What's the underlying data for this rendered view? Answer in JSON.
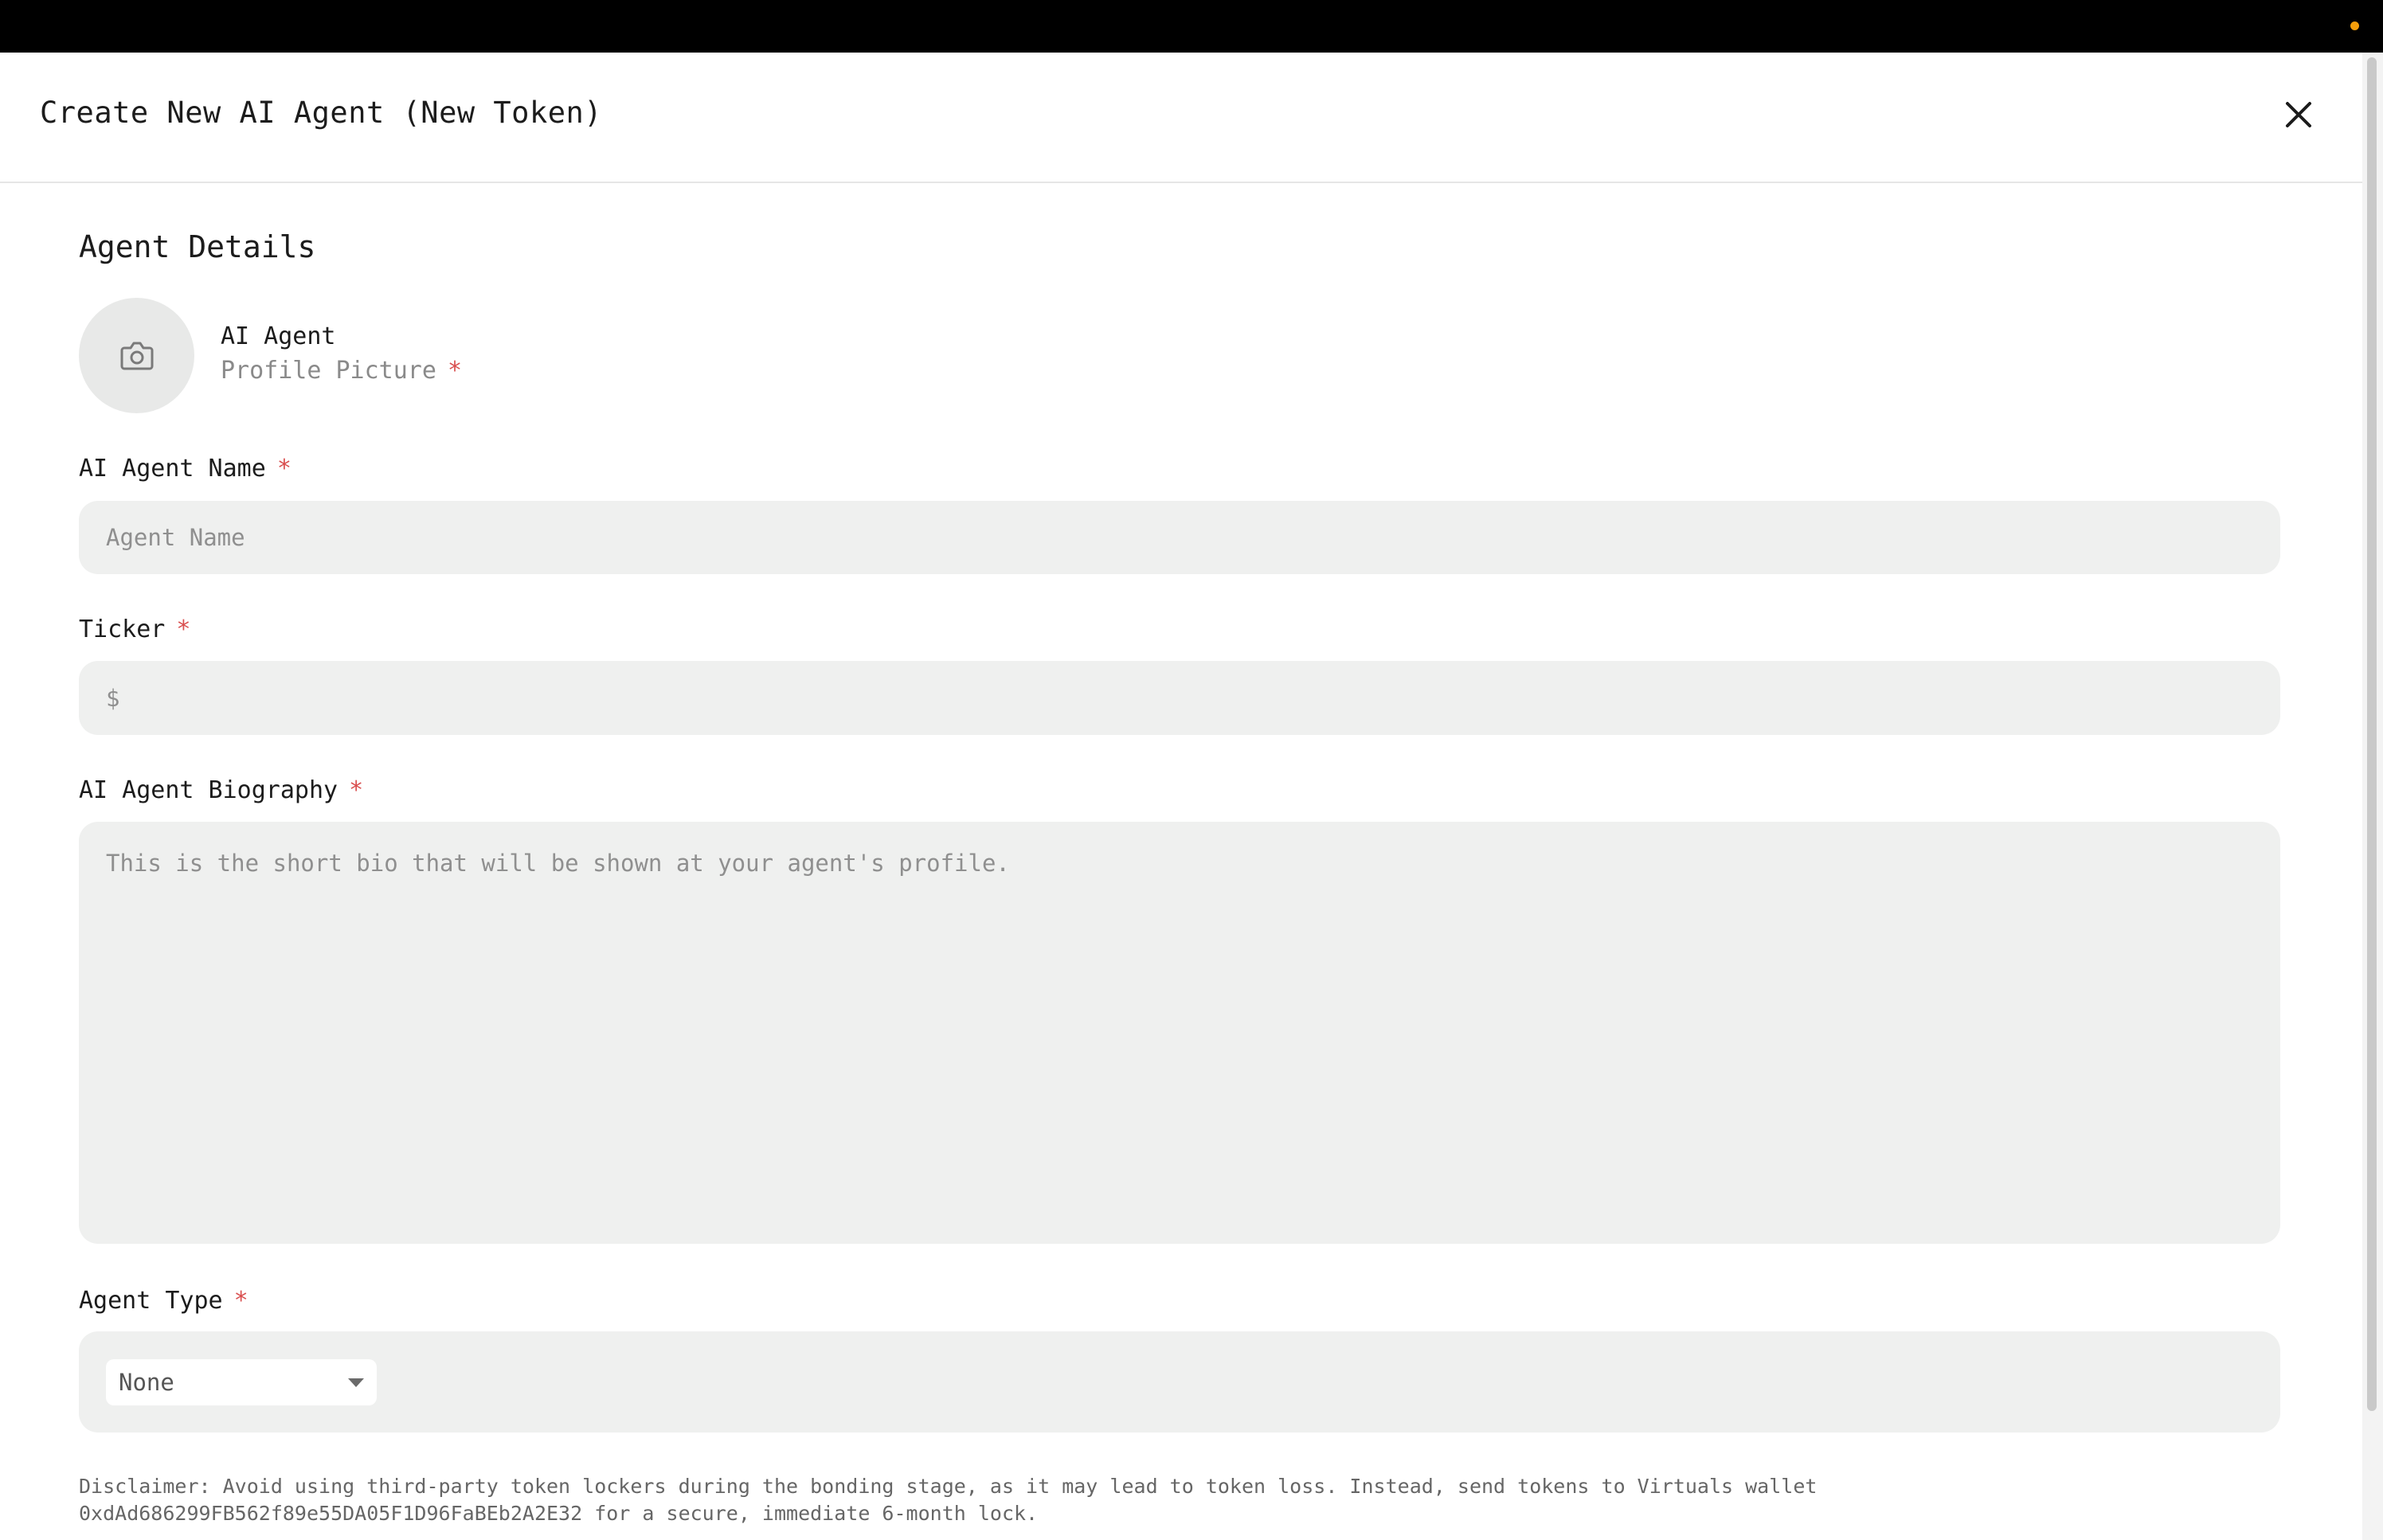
{
  "modal": {
    "title": "Create New AI Agent (New Token)"
  },
  "section": {
    "title": "Agent Details"
  },
  "profile_picture": {
    "line1": "AI Agent",
    "line2": "Profile Picture",
    "required_mark": "*"
  },
  "fields": {
    "name": {
      "label": "AI Agent Name",
      "required_mark": "*",
      "placeholder": "Agent Name",
      "value": ""
    },
    "ticker": {
      "label": "Ticker",
      "required_mark": "*",
      "placeholder": "$",
      "value": ""
    },
    "biography": {
      "label": "AI Agent Biography",
      "required_mark": "*",
      "placeholder": "This is the short bio that will be shown at your agent's profile.",
      "value": ""
    },
    "agent_type": {
      "label": "Agent Type",
      "required_mark": "*",
      "selected": "None"
    }
  },
  "disclaimer": "Disclaimer: Avoid using third-party token lockers during the bonding stage, as it may lead to token loss. Instead, send tokens to Virtuals wallet 0xdAd686299FB562f89e55DA05F1D96FaBEb2A2E32 for a secure, immediate 6-month lock.",
  "icons": {
    "close": "close-icon",
    "camera": "camera-icon",
    "dropdown": "chevron-down-icon"
  },
  "colors": {
    "required": "#d94f4f",
    "field_bg": "#eff0ef",
    "topbar": "#000000",
    "status_dot": "#f59e0b"
  }
}
